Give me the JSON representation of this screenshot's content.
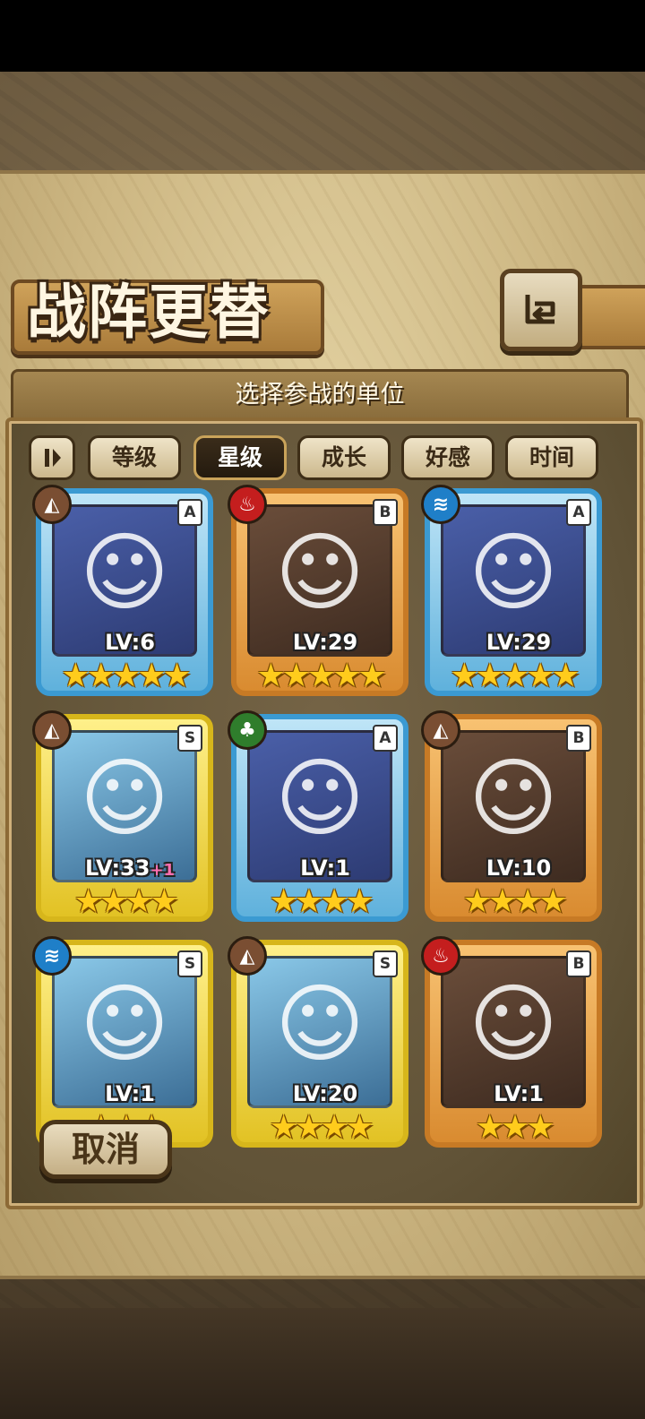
{
  "header": {
    "title": "战阵更替",
    "back_icon": "return-arrow-icon"
  },
  "subtitle": "选择参战的单位",
  "sort": {
    "toggle_icon": "pause-sort-icon",
    "tabs": [
      {
        "label": "等级",
        "active": false
      },
      {
        "label": "星级",
        "active": true
      },
      {
        "label": "成长",
        "active": false
      },
      {
        "label": "好感",
        "active": false
      },
      {
        "label": "时间",
        "active": false
      }
    ]
  },
  "units": [
    {
      "level": "LV:6",
      "bonus": "",
      "rank": "A",
      "element": "earth-icon",
      "stars": 5,
      "frame": "blue"
    },
    {
      "level": "LV:29",
      "bonus": "",
      "rank": "B",
      "element": "fire-icon",
      "stars": 5,
      "frame": "orange"
    },
    {
      "level": "LV:29",
      "bonus": "",
      "rank": "A",
      "element": "water-icon",
      "stars": 5,
      "frame": "blue"
    },
    {
      "level": "LV:33",
      "bonus": "+1",
      "rank": "S",
      "element": "earth-icon",
      "stars": 4,
      "frame": "gold"
    },
    {
      "level": "LV:1",
      "bonus": "",
      "rank": "A",
      "element": "wind-icon",
      "stars": 4,
      "frame": "blue"
    },
    {
      "level": "LV:10",
      "bonus": "",
      "rank": "B",
      "element": "earth-icon",
      "stars": 4,
      "frame": "orange"
    },
    {
      "level": "LV:1",
      "bonus": "",
      "rank": "S",
      "element": "water-icon",
      "stars": 3,
      "frame": "gold"
    },
    {
      "level": "LV:20",
      "bonus": "",
      "rank": "S",
      "element": "earth-icon",
      "stars": 4,
      "frame": "gold"
    },
    {
      "level": "LV:1",
      "bonus": "",
      "rank": "B",
      "element": "fire-icon",
      "stars": 3,
      "frame": "orange"
    }
  ],
  "cancel_label": "取消"
}
